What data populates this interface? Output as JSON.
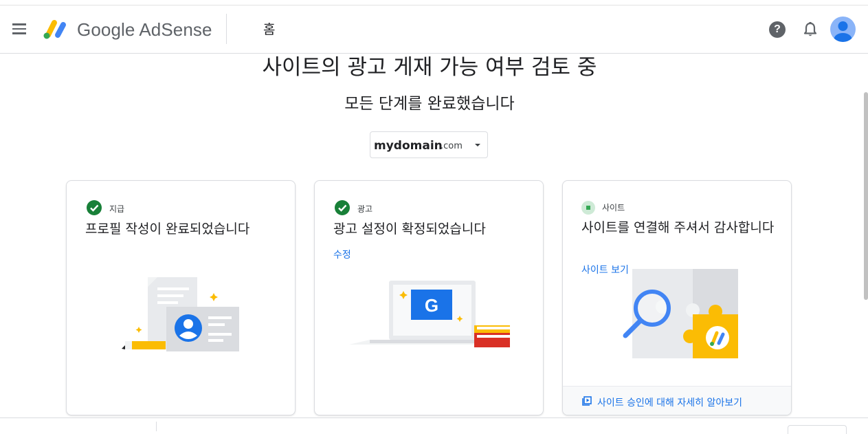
{
  "header": {
    "brand": "Google AdSense",
    "page_title": "홈",
    "help_glyph": "?"
  },
  "main": {
    "heading": "사이트의 광고 게재 가능 여부 검토 중",
    "subheading": "모든 단계를 완료했습니다",
    "site_selector": {
      "name": "mydomain",
      "tld": ".com"
    }
  },
  "cards": [
    {
      "status": "complete",
      "tag": "지급",
      "title": "프로필 작성이 완료되었습니다",
      "link": ""
    },
    {
      "status": "complete",
      "tag": "광고",
      "title": "광고 설정이 확정되었습니다",
      "link": "수정"
    },
    {
      "status": "in-progress",
      "tag": "사이트",
      "title": "사이트를 연결해 주셔서 감사합니다",
      "link": "사이트 보기",
      "footer_link": "사이트 승인에 대해 자세히 알아보기"
    }
  ],
  "colors": {
    "accent_blue": "#1a73e8",
    "success_green": "#188038",
    "pending_green": "#34a853",
    "adsense_yellow": "#fbbc04"
  },
  "icons": [
    "menu-icon",
    "adsense-logo-icon",
    "help-icon",
    "bell-icon",
    "avatar-icon",
    "check-circle-icon",
    "pending-square-icon",
    "video-library-icon"
  ]
}
